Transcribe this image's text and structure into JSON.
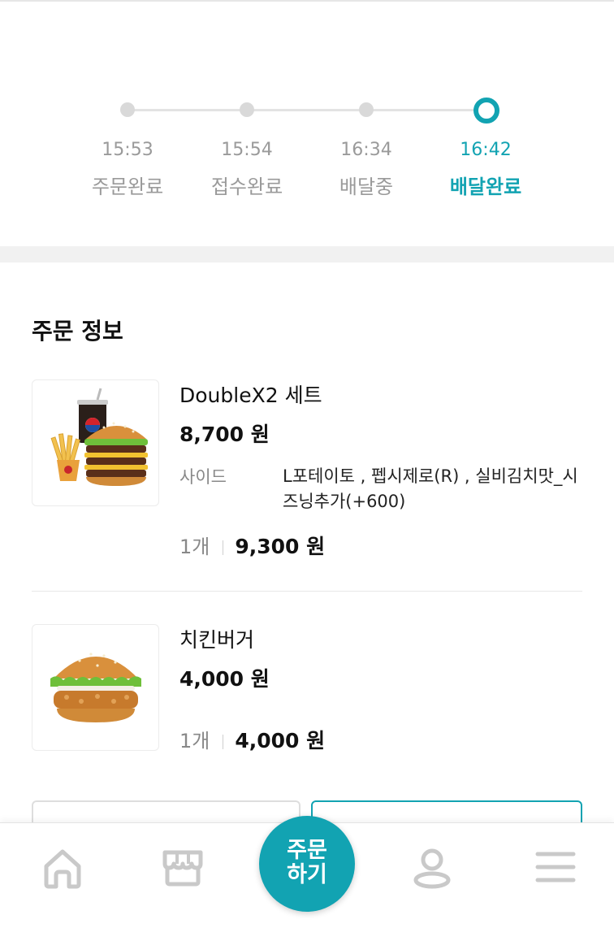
{
  "status_steps": [
    {
      "time": "15:53",
      "label": "주문완료",
      "state": "pending"
    },
    {
      "time": "15:54",
      "label": "접수완료",
      "state": "pending"
    },
    {
      "time": "16:34",
      "label": "배달중",
      "state": "pending"
    },
    {
      "time": "16:42",
      "label": "배달완료",
      "state": "done"
    }
  ],
  "order_info": {
    "title": "주문 정보",
    "items": [
      {
        "name": "DoubleX2 세트",
        "price": "8,700 원",
        "option_label": "사이드",
        "option_value": "L포테이토 , 펩시제로(R) , 실비김치맛_시즈닝추가(+600)",
        "quantity": "1개",
        "total": "9,300 원",
        "image_icon": "burger-set-image"
      },
      {
        "name": "치킨버거",
        "price": "4,000 원",
        "quantity": "1개",
        "total": "4,000 원",
        "image_icon": "chicken-burger-image"
      }
    ]
  },
  "bottom_nav": {
    "home_icon": "home-icon",
    "store_icon": "store-icon",
    "order_line1": "주문",
    "order_line2": "하기",
    "profile_icon": "person-icon",
    "menu_icon": "hamburger-menu-icon"
  },
  "colors": {
    "accent": "#12a3b2",
    "inactive": "#9a9a9a",
    "text": "#111111",
    "band": "#f1f1f1"
  }
}
